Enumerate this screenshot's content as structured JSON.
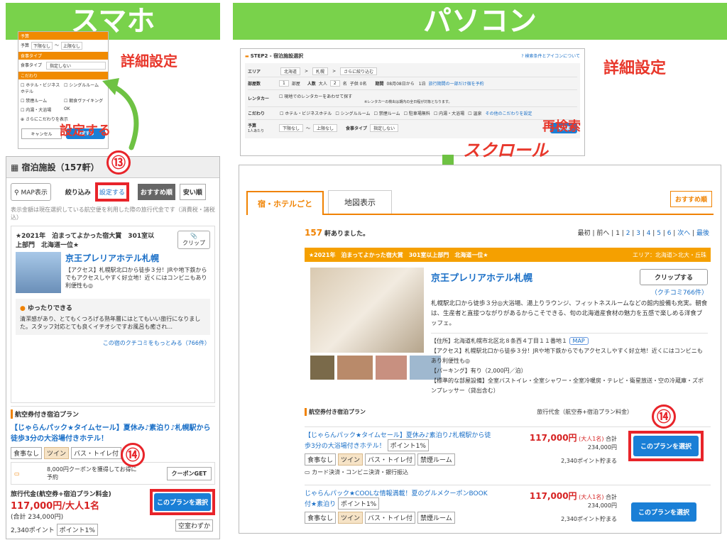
{
  "headers": {
    "sp": "スマホ",
    "pc": "パソコン"
  },
  "annotations": {
    "sp_detail": "詳細設定",
    "sp_set": "設定する",
    "pc_detail": "詳細設定",
    "pc_research": "再検索",
    "pc_scroll": "スクロール",
    "num13": "⑬",
    "num14": "⑭"
  },
  "sp_settings": {
    "budget_header": "予算",
    "budget_label": "予算",
    "budget_min": "下限なし",
    "budget_sep": "〜",
    "budget_max": "上限なし",
    "meal_header": "食事タイプ",
    "meal_label": "食事タイプ",
    "meal_value": "指定しない",
    "pref_header": "こだわり",
    "options": [
      "ホテル・ビジネスホテル",
      "シングルルーム",
      "禁煙ルーム",
      "朝食ヴァイキング",
      "内湯・大浴場",
      "OK",
      "さらにこだわりを表示"
    ],
    "cancel": "キャンセル",
    "submit": "設定する"
  },
  "sp_list": {
    "title": "宿泊施設（157軒）",
    "map_btn": "MAP表示",
    "filter_label": "絞り込み",
    "filter_btn": "設定する",
    "sort_rec": "おすすめ順",
    "sort_cheap": "安い順",
    "notice": "表示金額は現在選択している航空便を利用した際の旅行代金です（消費税・諸税込）",
    "award": "★2021年　泊まってよかった宿大賞　301室以上部門　北海道一位★",
    "clip": "クリップ",
    "hotel_name": "京王プレリアホテル札幌",
    "hotel_desc": "【アクセス】札幌駅北口から徒歩３分！JRや地下鉄からでもアクセスしやすく好立地！近くにはコンビニもあり利便性も◎",
    "review_title": "ゆったりできる",
    "review_text": "清潔感があり、とてもくつろげる熟年層にはとてもいい旅行になりました。スタッフ対応とても良くイチオシですお風呂も癒され...",
    "review_link": "この宿のクチコミをもっとみる（766件）",
    "plan_section": "航空券付き宿泊プラン",
    "plan_name": "【じゃらんパック★タイムセール】夏休み♪素泊り♪札幌駅から徒歩3分の大浴場付きホテル！",
    "tags": [
      "食事なし",
      "ツイン",
      "バス・トイレ付"
    ],
    "coupon_text": "8,000円クーポンを獲得してお得に予約",
    "coupon_amount": "8,000円",
    "coupon_btn": "クーポンGET",
    "price_label": "旅行代金(航空券+宿泊プラン料金)",
    "price": "117,000円/大人1名",
    "price_total": "(合計 234,000円)",
    "points": "2,340ポイント",
    "point_rate": "ポイント1%",
    "select_btn": "このプランを選択",
    "vacancy": "空室わずか"
  },
  "pc_search": {
    "step": "STEP2 - 宿泊施設選択",
    "help": "検索条件とアイコンについて",
    "area_label": "エリア",
    "area": [
      "北海道",
      "札幌",
      "さらに絞り込む"
    ],
    "rooms_label": "部屋数",
    "rooms": "1",
    "rooms_unit": "部屋",
    "people_label": "人数",
    "adults": "大人",
    "adult_count": "2",
    "adult_unit": "名",
    "child": "子供 0名",
    "period_label": "期間",
    "period": "08月08日から　1泊",
    "period_link": "旅行期間の一部だけ宿を予約",
    "rental_label": "レンタカー",
    "rental": "現地でのレンタカーをあわせて探す",
    "rental_note": "※レンタカーの検出は期内の全日程が対象となります。",
    "pref_label": "こだわり",
    "prefs": [
      "ホテル・ビジネスホテル",
      "シングルルーム",
      "禁煙ルーム",
      "駐車場無料",
      "内湯・大浴場",
      "温泉"
    ],
    "more_prefs": "その他のこだわりを設定",
    "budget_label": "予算",
    "budget_sub": "1人あたり",
    "budget_min": "下限なし",
    "budget_max": "上限なし",
    "meal_label": "食事タイプ",
    "meal": "指定しない",
    "research_btn": "再検索"
  },
  "pc_list": {
    "tab_hotel": "宿・ホテルごと",
    "tab_map": "地図表示",
    "sort": "おすすめ順",
    "count": "157",
    "count_suffix": "軒ありました。",
    "pager": [
      "最初",
      "前へ",
      "1",
      "2",
      "3",
      "4",
      "5",
      "6",
      "次へ",
      "最後"
    ],
    "award": "★2021年　泊まってよかった宿大賞　301室以上部門　北海道一位★",
    "area": "エリア：北海道＞北大・丘珠",
    "hotel_name": "京王プレリアホテル札幌",
    "clip": "クリップする",
    "review": "（クチコミ766件）",
    "desc": "札幌駅北口から徒歩３分◎大浴場、湯上りラウンジ、フィットネスルームなどの館内設備も充実。朝食は、生産者と直接つながりがあるからこそできる、旬の北海道産食材の魅力を五感で楽しめる洋食ブッフェ。",
    "address": "【住所】北海道札幌市北区北８条西４丁目１１番地１",
    "map": "MAP",
    "access": "【アクセス】札幌駅北口から徒歩３分！JRや地下鉄からでもアクセスしやすく好立地！近くにはコンビニもあり利便性も◎",
    "parking": "【パーキング】有り（2,000円／泊）",
    "amenities": "【標準的な部屋設備】全室バストイレ・全室シャワー・全室冷暖房・テレビ・衛星放送・空の冷蔵庫・ズボンプレッサー（貸出含む）",
    "plan_section": "航空券付き宿泊プラン",
    "price_header": "旅行代金（航空券+宿泊プラン料金）",
    "plans": [
      {
        "name": "【じゃらんパック★タイムセール】夏休み♪素泊り♪札幌駅から徒歩3分の大浴場付きホテル！",
        "point_tag": "ポイント1%",
        "tags": [
          "食事なし",
          "ツイン",
          "バス・トイレ付",
          "禁煙ルーム"
        ],
        "payment": "カード決済・コンビニ決済・銀行振込",
        "price": "117,000円",
        "per": "(大人1名)",
        "total": "合計 234,000円",
        "points": "2,340ポイント貯まる",
        "select": "このプランを選択"
      },
      {
        "name": "じゃらんパック★COOLな情報満載！夏のグルメクーポンBOOK付★素泊り",
        "point_tag": "ポイント1%",
        "tags": [
          "食事なし",
          "ツイン",
          "バス・トイレ付",
          "禁煙ルーム"
        ],
        "price": "117,000円",
        "per": "(大人1名)",
        "total": "合計 234,000円",
        "points": "2,340ポイント貯まる",
        "select": "このプランを選択"
      }
    ]
  },
  "colors": {
    "green": "#79d24b",
    "red": "#e8242a",
    "blue": "#1a7fd6",
    "orange": "#f08200"
  }
}
